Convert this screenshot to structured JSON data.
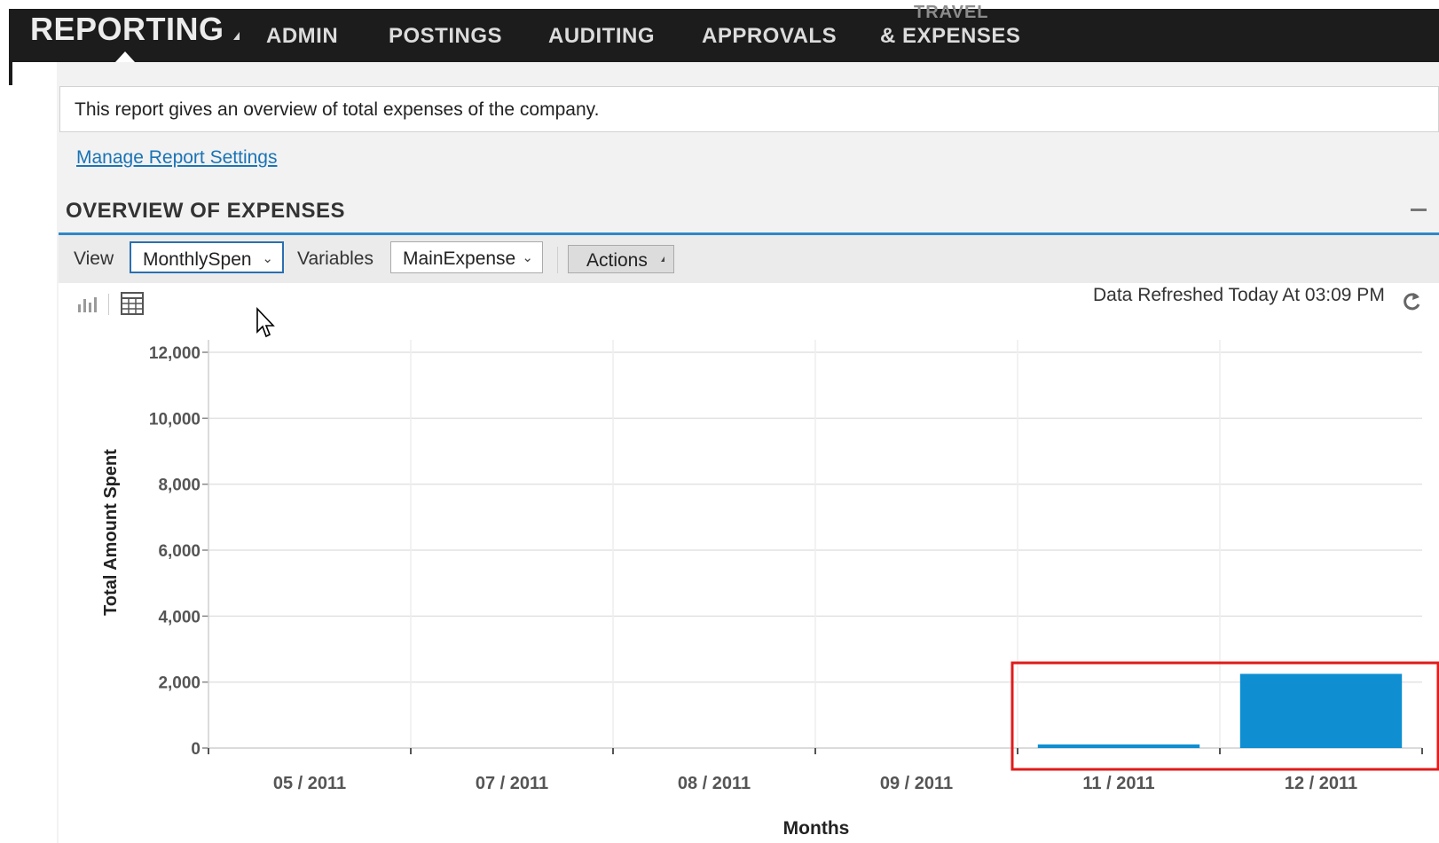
{
  "nav": {
    "brand": "REPORTING",
    "items": [
      "ADMIN",
      "POSTINGS",
      "AUDITING",
      "APPROVALS"
    ],
    "travel_top": "TRAVEL",
    "travel_bottom": "& EXPENSES"
  },
  "report": {
    "description": "This report gives an overview of total expenses of the company.",
    "manage_link": "Manage Report Settings",
    "section_title": "OVERVIEW OF EXPENSES"
  },
  "toolbar": {
    "view_label": "View",
    "view_value": "MonthlySpen",
    "variables_label": "Variables",
    "variables_value": "MainExpense",
    "actions_label": "Actions"
  },
  "chart_header": {
    "refreshed": "Data Refreshed Today At 03:09 PM",
    "icons": [
      "bar-chart-icon",
      "table-icon",
      "refresh-icon"
    ]
  },
  "colors": {
    "nav_bg": "#1c1c1c",
    "accent": "#2e87c8",
    "bar": "#0f8fd2",
    "highlight": "#e01b1b",
    "link": "#1a74b6"
  },
  "chart_data": {
    "type": "bar",
    "categories": [
      "05 / 2011",
      "07 / 2011",
      "08 / 2011",
      "09 / 2011",
      "11 / 2011",
      "12 / 2011"
    ],
    "values": [
      0,
      0,
      0,
      0,
      110,
      2250
    ],
    "xlabel": "Months",
    "ylabel": "Total Amount Spent",
    "ylim": [
      0,
      12000
    ],
    "yticks": [
      0,
      2000,
      4000,
      6000,
      8000,
      10000,
      12000
    ],
    "ytick_labels": [
      "0",
      "2,000",
      "4,000",
      "6,000",
      "8,000",
      "10,000",
      "12,000"
    ],
    "grid": true,
    "highlighted_categories": [
      "11 / 2011",
      "12 / 2011"
    ]
  }
}
